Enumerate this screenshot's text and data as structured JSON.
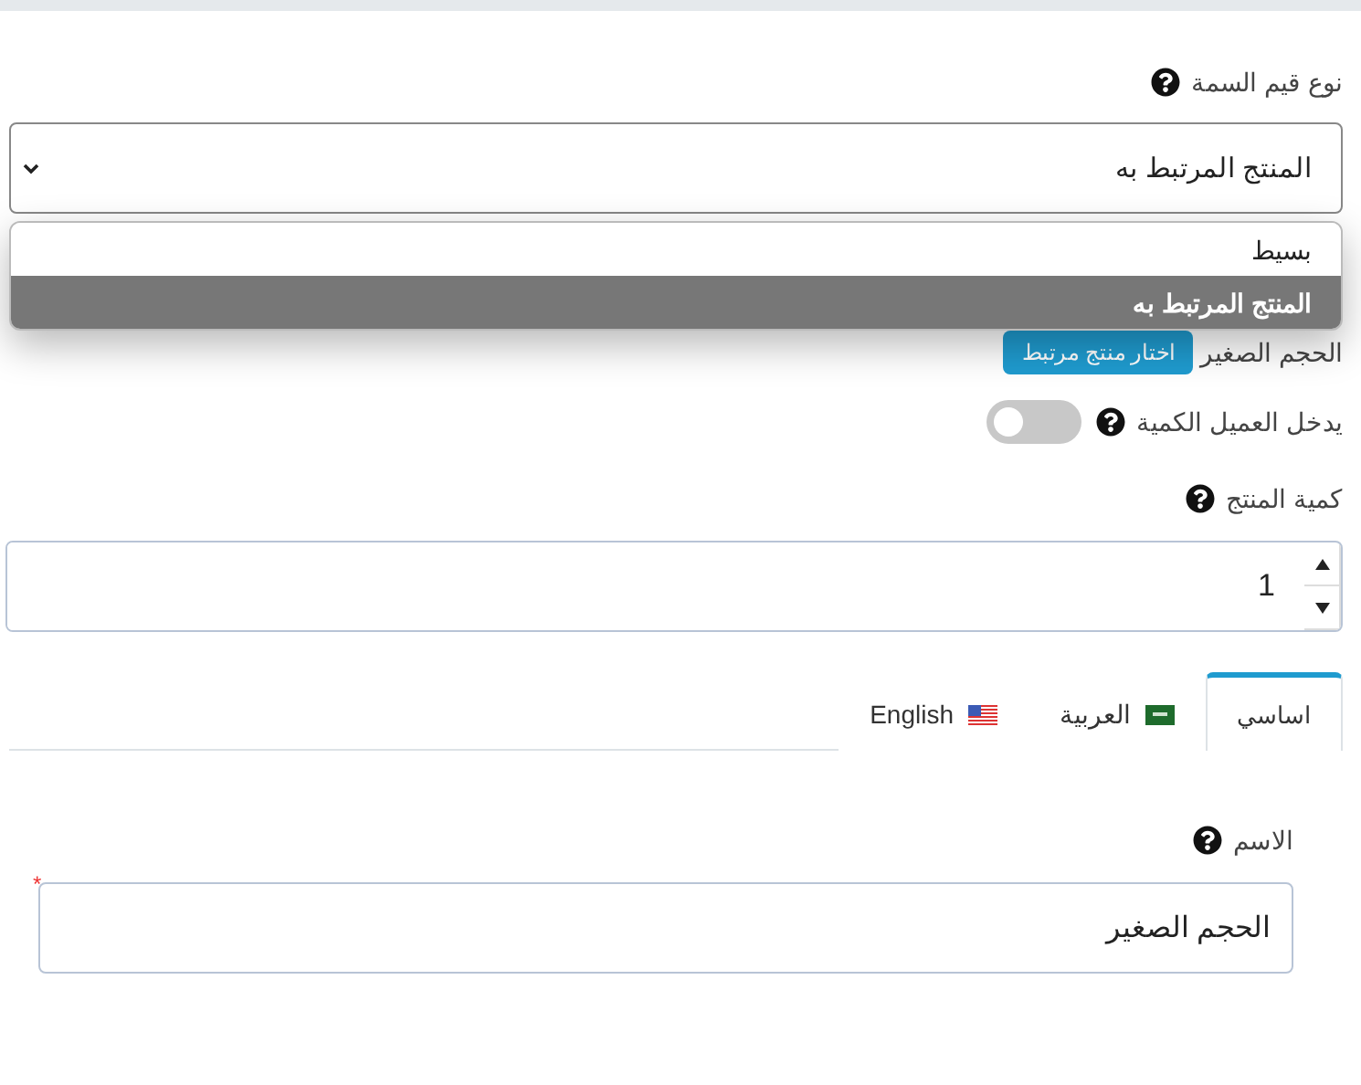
{
  "attribute_type": {
    "label": "نوع قيم السمة",
    "value": "المنتج المرتبط به",
    "options": [
      {
        "label": "بسيط",
        "selected": false
      },
      {
        "label": "المنتج المرتبط به",
        "selected": true
      }
    ]
  },
  "linked_product": {
    "label": "الحجم الصغير",
    "button": "اختار منتج مرتبط"
  },
  "customer_enters_quantity": {
    "label": "يدخل العميل الكمية",
    "on": false
  },
  "product_quantity": {
    "label": "كمية المنتج",
    "value": "1"
  },
  "tabs": [
    {
      "label": "اساسي",
      "kind": "plain",
      "selected": true
    },
    {
      "label": "العربية",
      "kind": "green-flag",
      "selected": false
    },
    {
      "label": "English",
      "kind": "striped-flag",
      "selected": false
    }
  ],
  "name_field": {
    "label": "الاسم",
    "value": "الحجم الصغير",
    "required_mark": "*"
  }
}
